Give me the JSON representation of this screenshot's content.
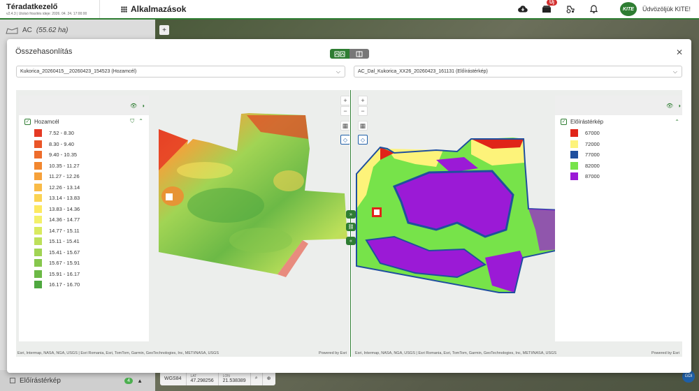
{
  "topbar": {
    "brand_title": "Téradatkezelő",
    "brand_sub": "v2.4.3 | Utolsó frissítés ideje: 2026. 04. 24. 17:00:00",
    "apps_label": "Alkalmazások",
    "notification_badge": "Új",
    "kite_logo": "KITE",
    "welcome": "Üdvözöljük KITE!"
  },
  "background": {
    "field_name": "AC",
    "field_area": "(55.62 ha)",
    "bottom_layer_label": "Előírástérkép",
    "bottom_layer_count": "4",
    "coord_system": "WGS84",
    "lat_label": "LAT",
    "lat_value": "47.298256",
    "lon_label": "LON",
    "lon_value": "21.538389",
    "gdi_label": "GDI"
  },
  "modal": {
    "title": "Összehasonlítás",
    "left_select": "Kukorica_20260415__20260423_154523 (Hozamcél)",
    "right_select": "AC_Dal_Kukorica_XX26_20260423_161131 (Előírástérkép)",
    "attribution": "Esri, Intermap, NASA, NGA, USGS | Esri Romania, Esri, TomTom, Garmin, GeoTechnologies, Inc, METI/NASA, USGS",
    "powered_by": "Powered by Esri"
  },
  "left_legend": {
    "title": "Hozamcél",
    "items": [
      {
        "label": "7.52 - 8.30",
        "color": "#e53a24"
      },
      {
        "label": "8.30 - 9.40",
        "color": "#ea5528"
      },
      {
        "label": "9.40 - 10.35",
        "color": "#ee6d2c"
      },
      {
        "label": "10.35 - 11.27",
        "color": "#f2872f"
      },
      {
        "label": "11.27 - 12.26",
        "color": "#f6a13a"
      },
      {
        "label": "12.26 - 13.14",
        "color": "#f9bb47"
      },
      {
        "label": "13.14 - 13.83",
        "color": "#fbd353"
      },
      {
        "label": "13.83 - 14.36",
        "color": "#fde961"
      },
      {
        "label": "14.36 - 14.77",
        "color": "#f3f06a"
      },
      {
        "label": "14.77 - 15.11",
        "color": "#d9ea5f"
      },
      {
        "label": "15.11 - 15.41",
        "color": "#bde05a"
      },
      {
        "label": "15.41 - 15.67",
        "color": "#a1d454"
      },
      {
        "label": "15.67 - 15.91",
        "color": "#86c74d"
      },
      {
        "label": "15.91 - 16.17",
        "color": "#6cb946"
      },
      {
        "label": "16.17 - 16.70",
        "color": "#4fa83f"
      }
    ]
  },
  "right_legend": {
    "title": "Előírástérkép",
    "items": [
      {
        "label": "67000",
        "color": "#e02419"
      },
      {
        "label": "72000",
        "color": "#fdf37a"
      },
      {
        "label": "77000",
        "color": "#1f4f9e"
      },
      {
        "label": "82000",
        "color": "#77e34a"
      },
      {
        "label": "87000",
        "color": "#9b1ad6"
      }
    ]
  }
}
